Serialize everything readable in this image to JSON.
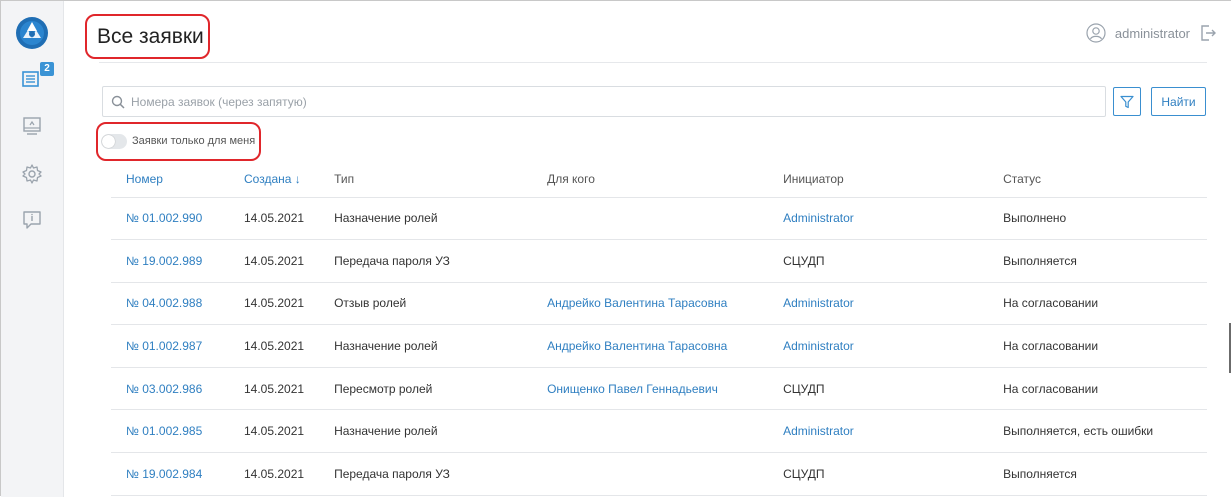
{
  "header": {
    "title": "Все заявки",
    "user_name": "administrator"
  },
  "sidebar": {
    "items": [
      {
        "icon": "requests-icon",
        "badge": "2"
      },
      {
        "icon": "monitor-icon"
      },
      {
        "icon": "gear-icon"
      },
      {
        "icon": "feedback-icon"
      }
    ]
  },
  "search": {
    "placeholder": "Номера заявок (через запятую)",
    "find_label": "Найти"
  },
  "toggle": {
    "label": "Заявки только для меня",
    "checked": false
  },
  "table": {
    "columns": [
      "Номер",
      "Создана ↓",
      "Тип",
      "Для кого",
      "Инициатор",
      "Статус"
    ],
    "rows": [
      {
        "number": "№ 01.002.990",
        "created": "14.05.2021",
        "type": "Назначение ролей",
        "for_whom": "",
        "initiator": "Administrator",
        "status": "Выполнено"
      },
      {
        "number": "№ 19.002.989",
        "created": "14.05.2021",
        "type": "Передача пароля УЗ",
        "for_whom": "",
        "initiator": "СЦУДП",
        "status": "Выполняется"
      },
      {
        "number": "№ 04.002.988",
        "created": "14.05.2021",
        "type": "Отзыв ролей",
        "for_whom": "Андрейко Валентина Тарасовна",
        "initiator": "Administrator",
        "status": "На согласовании"
      },
      {
        "number": "№ 01.002.987",
        "created": "14.05.2021",
        "type": "Назначение ролей",
        "for_whom": "Андрейко Валентина Тарасовна",
        "initiator": "Administrator",
        "status": "На согласовании"
      },
      {
        "number": "№ 03.002.986",
        "created": "14.05.2021",
        "type": "Пересмотр ролей",
        "for_whom": "Онищенко Павел Геннадьевич",
        "initiator": "СЦУДП",
        "status": "На согласовании"
      },
      {
        "number": "№ 01.002.985",
        "created": "14.05.2021",
        "type": "Назначение ролей",
        "for_whom": "",
        "initiator": "Administrator",
        "status": "Выполняется, есть ошибки"
      },
      {
        "number": "№ 19.002.984",
        "created": "14.05.2021",
        "type": "Передача пароля УЗ",
        "for_whom": "",
        "initiator": "СЦУДП",
        "status": "Выполняется"
      }
    ]
  },
  "colors": {
    "accent": "#2f7fc1",
    "highlight": "#e0262b",
    "sidebar_bg": "#f3f4f6"
  }
}
